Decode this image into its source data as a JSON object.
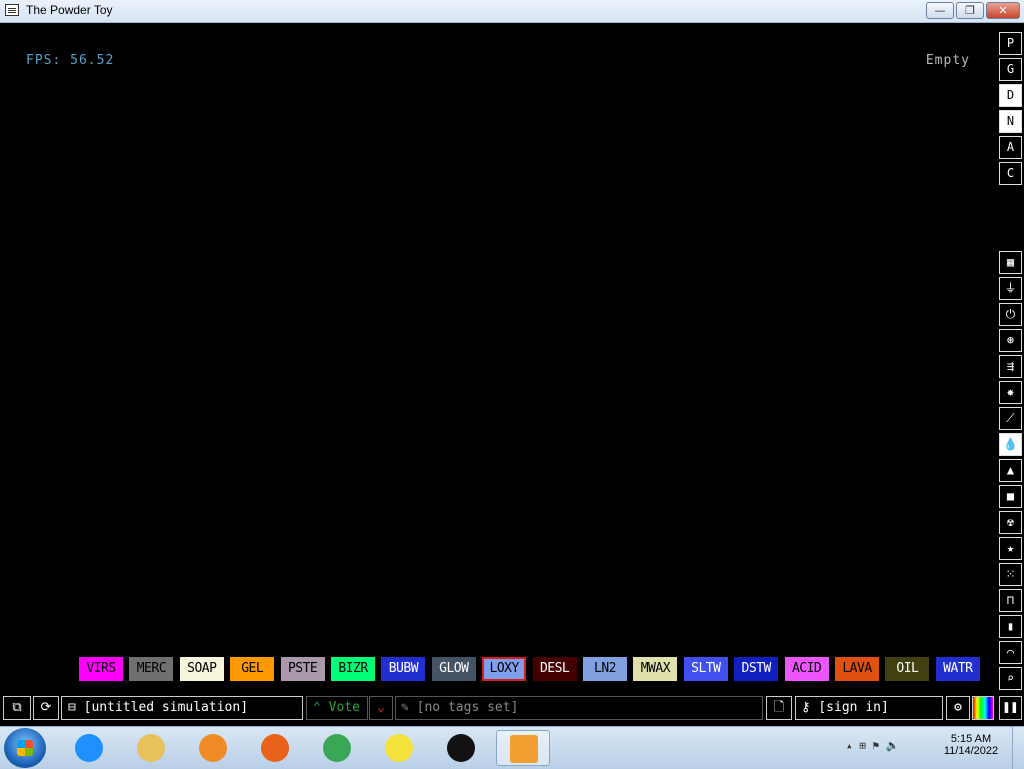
{
  "window": {
    "title": "The Powder Toy",
    "minimize_glyph": "—",
    "maximize_glyph": "❐",
    "close_glyph": "✕"
  },
  "hud": {
    "fps": "FPS: 56.52",
    "hover_element": "Empty"
  },
  "right_toolbar": {
    "render_modes": [
      {
        "label": "P",
        "selected": false
      },
      {
        "label": "G",
        "selected": false
      },
      {
        "label": "D",
        "selected": true
      },
      {
        "label": "N",
        "selected": true
      },
      {
        "label": "A",
        "selected": false
      },
      {
        "label": "C",
        "selected": false
      }
    ],
    "categories": [
      {
        "name": "walls-icon",
        "glyph": "▦"
      },
      {
        "name": "electronics-icon",
        "glyph": "⏚"
      },
      {
        "name": "powered-icon",
        "glyph": "⏻"
      },
      {
        "name": "sensors-icon",
        "glyph": "⊛"
      },
      {
        "name": "force-icon",
        "glyph": "⇶"
      },
      {
        "name": "explosives-icon",
        "glyph": "✸"
      },
      {
        "name": "gases-icon",
        "glyph": "⟋"
      },
      {
        "name": "liquids-icon",
        "glyph": "💧",
        "selected": true
      },
      {
        "name": "powders-icon",
        "glyph": "▲"
      },
      {
        "name": "solids-icon",
        "glyph": "■"
      },
      {
        "name": "radioactive-icon",
        "glyph": "☢"
      },
      {
        "name": "special-icon",
        "glyph": "★"
      },
      {
        "name": "life-icon",
        "glyph": "⁙"
      },
      {
        "name": "tools-icon",
        "glyph": "⊓"
      },
      {
        "name": "favorites-icon",
        "glyph": "▮"
      },
      {
        "name": "decoration-icon",
        "glyph": "⌒"
      },
      {
        "name": "search-icon",
        "glyph": "⌕"
      }
    ]
  },
  "elements": [
    {
      "label": "VIRS",
      "bg": "#ff00ff",
      "fg": "#000000"
    },
    {
      "label": "MERC",
      "bg": "#707070",
      "fg": "#000000"
    },
    {
      "label": "SOAP",
      "bg": "#f5f5dc",
      "fg": "#000000"
    },
    {
      "label": "GEL",
      "bg": "#ff9900",
      "fg": "#000000"
    },
    {
      "label": "PSTE",
      "bg": "#aa99aa",
      "fg": "#000000"
    },
    {
      "label": "BIZR",
      "bg": "#00ff77",
      "fg": "#000000"
    },
    {
      "label": "BUBW",
      "bg": "#2030d0",
      "fg": "#ffffff"
    },
    {
      "label": "GLOW",
      "bg": "#445464",
      "fg": "#ffffff"
    },
    {
      "label": "LOXY",
      "bg": "#80a0ef",
      "fg": "#000000",
      "selected": true
    },
    {
      "label": "DESL",
      "bg": "#440000",
      "fg": "#ffffff"
    },
    {
      "label": "LN2",
      "bg": "#80a0df",
      "fg": "#000000"
    },
    {
      "label": "MWAX",
      "bg": "#e0e0aa",
      "fg": "#000000"
    },
    {
      "label": "SLTW",
      "bg": "#4050f0",
      "fg": "#ffffff"
    },
    {
      "label": "DSTW",
      "bg": "#1020c0",
      "fg": "#ffffff"
    },
    {
      "label": "ACID",
      "bg": "#ed55ff",
      "fg": "#000000"
    },
    {
      "label": "LAVA",
      "bg": "#e05010",
      "fg": "#000000"
    },
    {
      "label": "OIL",
      "bg": "#404010",
      "fg": "#ffffff"
    },
    {
      "label": "WATR",
      "bg": "#2030d0",
      "fg": "#ffffff"
    }
  ],
  "bottom_bar": {
    "save_title": "[untitled simulation]",
    "vote_label": "Vote",
    "tags_label": "[no tags set]",
    "sign_in_label": "[sign in]"
  },
  "taskbar": {
    "apps": [
      {
        "name": "internet-explorer-icon",
        "color": "#1e90ff"
      },
      {
        "name": "file-explorer-icon",
        "color": "#e8c15a"
      },
      {
        "name": "media-player-icon",
        "color": "#f08a24"
      },
      {
        "name": "firefox-icon",
        "color": "#e8621c"
      },
      {
        "name": "chrome-icon",
        "color": "#3aa757"
      },
      {
        "name": "spongebob-icon",
        "color": "#f2e23a"
      },
      {
        "name": "pingu-icon",
        "color": "#111111"
      },
      {
        "name": "powder-toy-icon",
        "color": "#f0a030",
        "active": true
      }
    ],
    "time": "5:15 AM",
    "date": "11/14/2022"
  }
}
